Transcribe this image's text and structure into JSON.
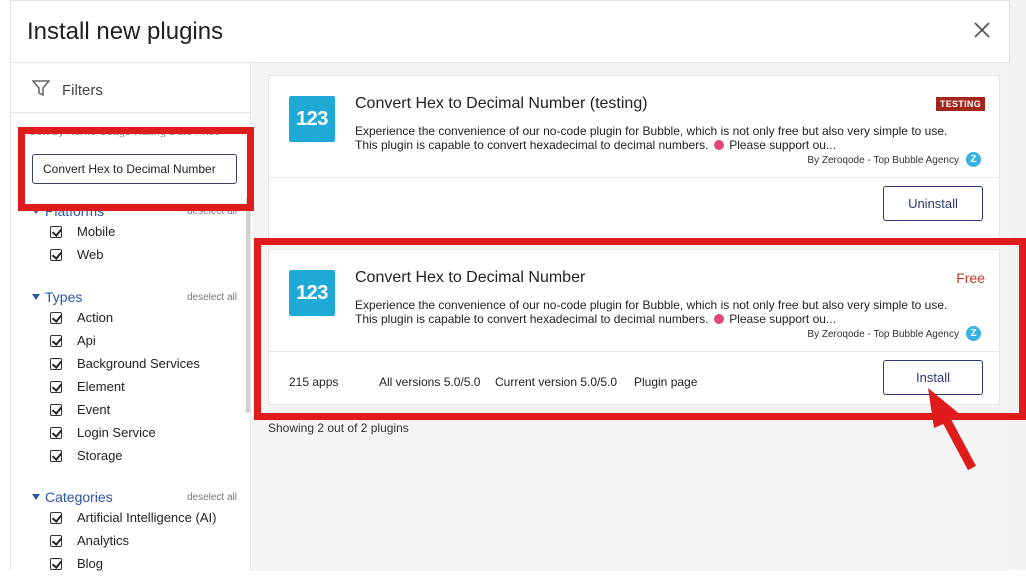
{
  "modal": {
    "title": "Install new plugins"
  },
  "sidebar": {
    "filters_label": "Filters",
    "sort_row": "Sort by   Name   Usage   Rating   Date   Price",
    "search_value": "Convert Hex to Decimal Number",
    "deselect_label": "deselect all",
    "sections": {
      "platforms": {
        "title": "Platforms",
        "items": [
          "Mobile",
          "Web"
        ]
      },
      "types": {
        "title": "Types",
        "items": [
          "Action",
          "Api",
          "Background Services",
          "Element",
          "Event",
          "Login Service",
          "Storage"
        ]
      },
      "categories": {
        "title": "Categories",
        "items": [
          "Artificial Intelligence (AI)",
          "Analytics",
          "Blog"
        ]
      }
    }
  },
  "plugins": [
    {
      "logo_text": "123",
      "title": "Convert Hex to Decimal Number (testing)",
      "badge": "TESTING",
      "description_1": "Experience the convenience of our no-code plugin for Bubble, which is not only free but also very simple to use.",
      "description_2": "This plugin is capable to convert hexadecimal to decimal numbers.",
      "description_3": "Please support ou...",
      "author": "By Zeroqode - Top Bubble Agency",
      "author_badge": "Z",
      "action_label": "Uninstall"
    },
    {
      "logo_text": "123",
      "title": "Convert Hex to Decimal Number",
      "price": "Free",
      "description_1": "Experience the convenience of our no-code plugin for Bubble, which is not only free but also very simple to use.",
      "description_2": "This plugin is capable to convert hexadecimal to decimal numbers.",
      "description_3": "Please support ou...",
      "author": "By Zeroqode - Top Bubble Agency",
      "author_badge": "Z",
      "apps": "215 apps",
      "all_versions": "All versions 5.0/5.0",
      "current_version": "Current version 5.0/5.0",
      "plugin_page": "Plugin page",
      "action_label": "Install"
    }
  ],
  "results_summary": "Showing 2 out of 2 plugins",
  "colors": {
    "accent": "#2a55a6",
    "highlight": "#e01b1b",
    "logo": "#1fa9d6",
    "badge": "#a3261c",
    "free": "#c0392b"
  }
}
